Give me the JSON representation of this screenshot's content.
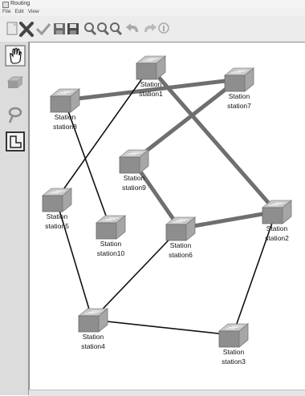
{
  "window": {
    "title": "Routing"
  },
  "menu": {
    "items": [
      "File",
      "Edit",
      "View"
    ]
  },
  "toolbar": {
    "icons": [
      "new-icon",
      "delete-icon",
      "check-icon",
      "save-icon",
      "save-as-icon",
      "zoom-in-icon",
      "zoom-out-icon",
      "zoom-fit-icon",
      "undo-icon",
      "redo-icon",
      "info-icon"
    ]
  },
  "sidebar": {
    "tools": [
      "hand-tool-icon",
      "router-tool-icon",
      "link-tool-icon",
      "select-region-icon"
    ]
  },
  "diagram": {
    "nodes": [
      {
        "id": "station1",
        "type_label": "Station",
        "name": "station1"
      },
      {
        "id": "station7",
        "type_label": "Station",
        "name": "station7"
      },
      {
        "id": "station8",
        "type_label": "Station",
        "name": "station8"
      },
      {
        "id": "station9",
        "type_label": "Station",
        "name": "station9"
      },
      {
        "id": "station5",
        "type_label": "Station",
        "name": "station5"
      },
      {
        "id": "station10",
        "type_label": "Station",
        "name": "station10"
      },
      {
        "id": "station6",
        "type_label": "Station",
        "name": "station6"
      },
      {
        "id": "station2",
        "type_label": "Station",
        "name": "station2"
      },
      {
        "id": "station4",
        "type_label": "Station",
        "name": "station4"
      },
      {
        "id": "station3",
        "type_label": "Station",
        "name": "station3"
      }
    ],
    "links": [
      {
        "from": "station8",
        "to": "station7",
        "style": "thick"
      },
      {
        "from": "station1",
        "to": "station2",
        "style": "thick"
      },
      {
        "from": "station7",
        "to": "station9",
        "style": "thick"
      },
      {
        "from": "station9",
        "to": "station6",
        "style": "thick"
      },
      {
        "from": "station6",
        "to": "station2",
        "style": "thick"
      },
      {
        "from": "station1",
        "to": "station5",
        "style": "thin"
      },
      {
        "from": "station8",
        "to": "station10",
        "style": "thin"
      },
      {
        "from": "station5",
        "to": "station4",
        "style": "thin"
      },
      {
        "from": "station4",
        "to": "station6",
        "style": "thin"
      },
      {
        "from": "station4",
        "to": "station3",
        "style": "thin"
      },
      {
        "from": "station2",
        "to": "station3",
        "style": "thin"
      }
    ]
  }
}
